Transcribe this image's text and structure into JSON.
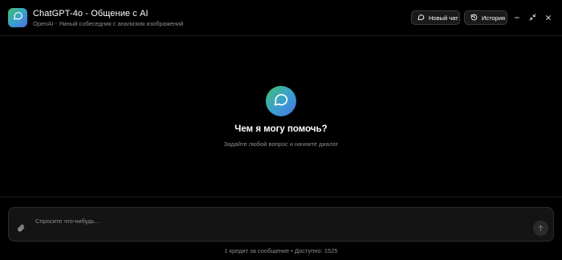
{
  "app": {
    "title": "ChatGPT-4o - Общение с AI",
    "subtitle": "OpenAI - Умный собеседник с анализом изображений",
    "icon": "chat-bubble-icon",
    "accent_gradient": [
      "#3fbf6f",
      "#3a9fd0",
      "#4b6fe0"
    ]
  },
  "header": {
    "new_chat_label": "Новый чат",
    "new_chat_icon": "chat-bubble-icon",
    "history_label": "История",
    "history_icon": "history-icon",
    "window_controls": [
      "minimize-icon",
      "shrink-icon",
      "close-icon"
    ]
  },
  "empty_state": {
    "icon": "chat-bubble-icon",
    "headline": "Чем я могу помочь?",
    "hint": "Задайте любой вопрос и начните диалог"
  },
  "composer": {
    "placeholder": "Спросите что-нибудь...",
    "value": "",
    "attach_icon": "paperclip-icon",
    "send_icon": "arrow-up-icon"
  },
  "footer": {
    "note": "1 кредит за сообщение • Доступно: 1525"
  }
}
